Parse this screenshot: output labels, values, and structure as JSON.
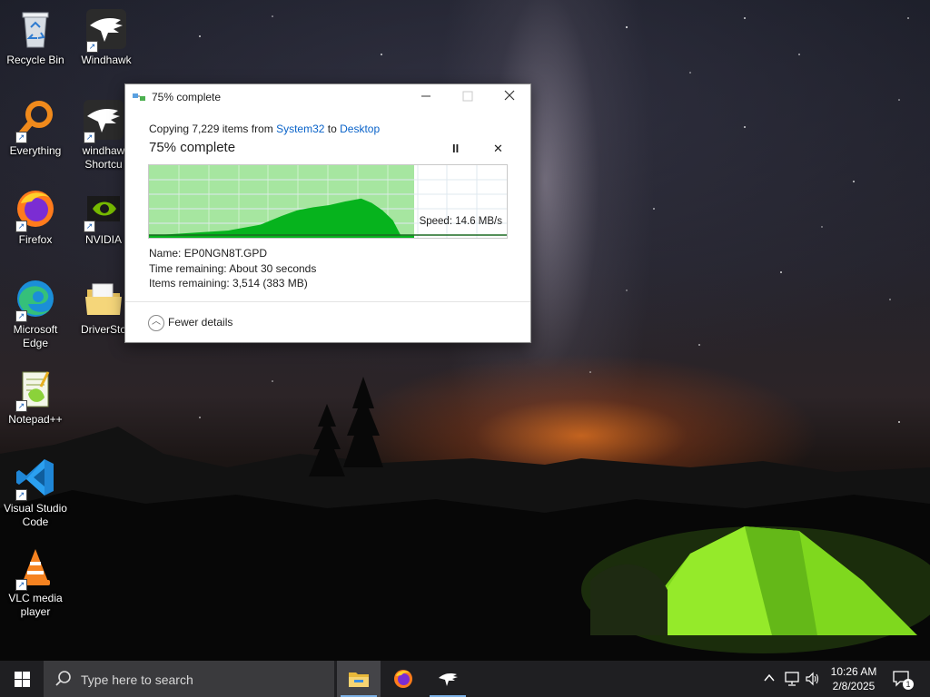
{
  "desktop": {
    "icons": [
      {
        "label": "Recycle Bin",
        "icon": "recycle-bin-icon"
      },
      {
        "label": "Windhawk",
        "icon": "windhawk-icon"
      },
      {
        "label": "Everything",
        "icon": "everything-search-icon"
      },
      {
        "label": "windhawk Shortcut",
        "line1": "windhaw",
        "line2": "Shortcu",
        "icon": "windhawk-icon"
      },
      {
        "label": "Firefox",
        "icon": "firefox-icon"
      },
      {
        "label": "NVIDIA",
        "icon": "nvidia-icon"
      },
      {
        "label": "Microsoft Edge",
        "line1": "Microsoft",
        "line2": "Edge",
        "icon": "edge-icon"
      },
      {
        "label": "DriverSto",
        "icon": "folder-icon"
      },
      {
        "label": "Notepad++",
        "icon": "notepadpp-icon"
      },
      {
        "label": "Visual Studio Code",
        "line1": "Visual Studio",
        "line2": "Code",
        "icon": "vscode-icon"
      },
      {
        "label": "VLC media player",
        "line1": "VLC media",
        "line2": "player",
        "icon": "vlc-icon"
      }
    ]
  },
  "dialog": {
    "title": "75% complete",
    "copy_prefix": "Copying 7,229 items from ",
    "source": "System32",
    "copy_mid": " to ",
    "destination": "Desktop",
    "progress_text": "75% complete",
    "progress_fraction": 0.75,
    "speed": "Speed: 14.6 MB/s",
    "name_label": "Name:",
    "name_value": "EP0NGN8T.GPD",
    "time_label": "Time remaining:",
    "time_value": "About 30 seconds",
    "items_label": "Items remaining:",
    "items_value": "3,514 (383 MB)",
    "fewer_details": "Fewer details",
    "pause_glyph": "II",
    "stop_glyph": "✕"
  },
  "taskbar": {
    "search_placeholder": "Type here to search",
    "apps": [
      "file-explorer",
      "firefox",
      "windhawk"
    ],
    "time": "10:26 AM",
    "date": "2/8/2025",
    "notification_count": "1"
  },
  "colors": {
    "graph_fill": "#a6e6a0",
    "graph_area": "#06b31d",
    "link": "#0a63c9",
    "taskbar": "#1f1f22"
  }
}
